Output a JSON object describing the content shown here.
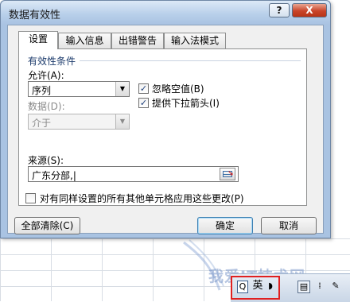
{
  "dialog": {
    "title": "数据有效性",
    "help_label": "?",
    "close_label": "X"
  },
  "tabs": [
    {
      "label": "设置",
      "active": true
    },
    {
      "label": "输入信息",
      "active": false
    },
    {
      "label": "出错警告",
      "active": false
    },
    {
      "label": "输入法模式",
      "active": false
    }
  ],
  "settings": {
    "group_label": "有效性条件",
    "allow": {
      "label": "允许(A):",
      "value": "序列"
    },
    "data": {
      "label": "数据(D):",
      "value": "介于"
    },
    "ignore_blank": {
      "label": "忽略空值(B)",
      "checked": true
    },
    "in_cell_dropdown": {
      "label": "提供下拉箭头(I)",
      "checked": true
    },
    "source": {
      "label": "来源(S):",
      "value": "广东分部,|"
    },
    "apply_all": {
      "label": "对有同样设置的所有其他单元格应用这些更改(P)",
      "checked": false
    }
  },
  "buttons": {
    "clear_all": "全部清除(C)",
    "ok": "确定",
    "cancel": "取消"
  },
  "taskbar": {
    "ime_label": "英"
  },
  "watermark": "我爱IT技术网",
  "colors": {
    "title_bar": "#b9d0ea",
    "close_button": "#c9452a",
    "highlight_box": "#e02020"
  }
}
